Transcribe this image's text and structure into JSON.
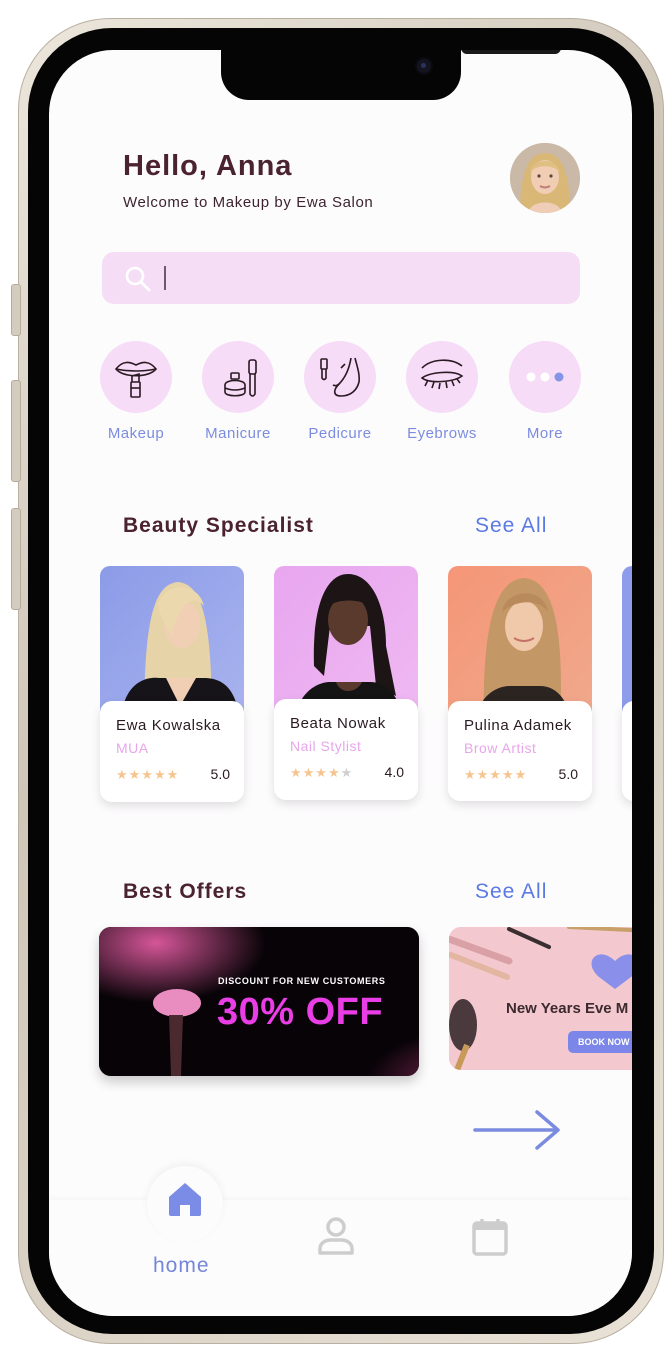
{
  "header": {
    "greeting": "Hello, Anna",
    "welcome": "Welcome to Makeup by Ewa Salon"
  },
  "search": {
    "placeholder": ""
  },
  "categories": [
    {
      "label": "Makeup",
      "icon": "lips-lipstick-icon"
    },
    {
      "label": "Manicure",
      "icon": "nail-polish-icon"
    },
    {
      "label": "Pedicure",
      "icon": "foot-icon"
    },
    {
      "label": "Eyebrows",
      "icon": "eye-lashes-icon"
    },
    {
      "label": "More",
      "icon": "more-dots-icon"
    }
  ],
  "specialists_section": {
    "title": "Beauty Specialist",
    "see_all": "See All"
  },
  "specialists": [
    {
      "name": "Ewa Kowalska",
      "role": "MUA",
      "rating": "5.0",
      "stars": 5,
      "bg": "#8f9fea"
    },
    {
      "name": "Beata Nowak",
      "role": "Nail Stylist",
      "rating": "4.0",
      "stars": 4,
      "bg": "#e7a8ef"
    },
    {
      "name": "Pulina Adamek",
      "role": "Brow Artist",
      "rating": "5.0",
      "stars": 5,
      "bg": "#f29c7c"
    }
  ],
  "offers_section": {
    "title": "Best Offers",
    "see_all": "See All"
  },
  "offers": [
    {
      "subtitle": "DISCOUNT FOR NEW CUSTOMERS",
      "headline": "30% OFF"
    },
    {
      "headline": "New Years Eve M",
      "button": "BOOK NOW"
    }
  ],
  "nav": {
    "home_label": "home"
  },
  "colors": {
    "accent": "#7b8ce0",
    "title": "#4b2330",
    "category_bg": "#f6dcf6",
    "search_bg": "#f5def5",
    "role_pink": "#e7a6ea",
    "star": "#f6c58f",
    "offer_pink": "#e93ee6"
  }
}
